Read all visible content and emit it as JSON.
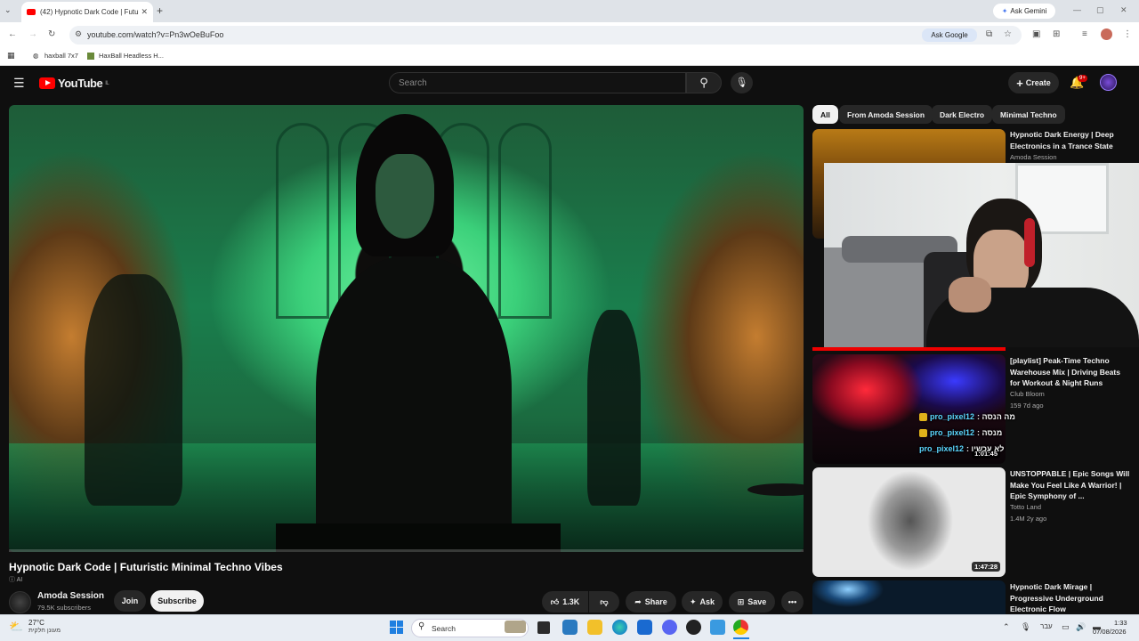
{
  "browser": {
    "tab_title": "(42) Hypnotic Dark Code | Futu",
    "url": "youtube.com/watch?v=Pn3wOeBuFoo",
    "ask_gemini": "Ask Gemini",
    "ask_google": "Ask Google",
    "bookmarks": [
      "haxball 7x7",
      "HaxBall Headless H..."
    ]
  },
  "youtube": {
    "logo_text": "YouTube",
    "logo_region": "IL",
    "search_placeholder": "Search",
    "create_label": "Create",
    "notification_badge": "9+"
  },
  "video": {
    "title": "Hypnotic Dark Code | Futuristic Minimal Techno Vibes",
    "ai_label": "AI",
    "channel": "Amoda Session",
    "subscribers": "79.5K subscribers",
    "join_label": "Join",
    "subscribe_label": "Subscribe",
    "likes": "1.3K",
    "share_label": "Share",
    "ask_label": "Ask",
    "save_label": "Save"
  },
  "chips": [
    "All",
    "From Amoda Session",
    "Dark Electro",
    "Minimal Techno"
  ],
  "recommendations": [
    {
      "title": "Hypnotic Dark Energy | Deep Electronics in a Trance State",
      "channel": "Amoda Session"
    },
    {
      "title": "[playlist] Peak-Time Techno Warehouse Mix | Driving Beats for Workout & Night Runs",
      "channel": "Club Bloom",
      "meta": "159  7d ago",
      "duration": "1:01:45"
    },
    {
      "title": "UNSTOPPABLE | Epic Songs Will Make You Feel Like A Warrior! | Epic Symphony of ...",
      "channel": "Totto Land",
      "meta": "1.4M  2y ago",
      "duration": "1:47:28"
    },
    {
      "title": "Hypnotic Dark Mirage | Progressive Underground Electronic Flow",
      "channel": ""
    }
  ],
  "overlay_chat": [
    {
      "user": "pro_pixel12",
      "msg": "מה הנסה :"
    },
    {
      "user": "pro_pixel12",
      "msg": "מנסה :"
    },
    {
      "user": "pro_pixel12",
      "msg": "לא עכשיו :"
    }
  ],
  "taskbar": {
    "weather_temp": "27°C",
    "weather_desc": "מעונן חלקית",
    "search_label": "Search",
    "lang": "עבר",
    "time": "1:33",
    "date": "07/08/2026"
  }
}
